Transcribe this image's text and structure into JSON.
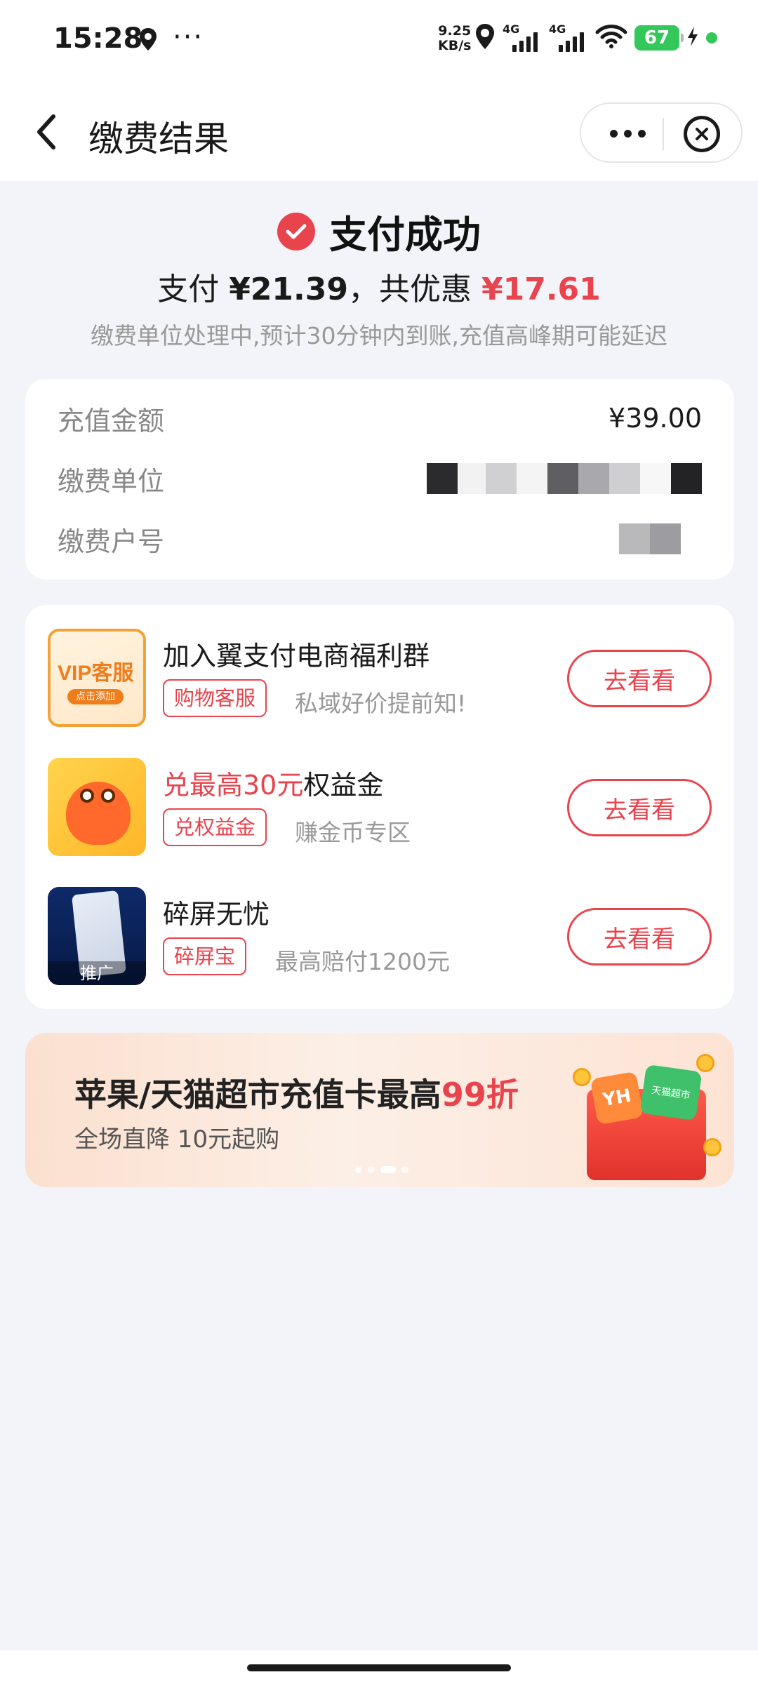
{
  "status_bar": {
    "time": "15:28",
    "more": "···",
    "net_speed_value": "9.25",
    "net_speed_unit": "KB/s",
    "signal1_label": "4G",
    "signal2_label": "4G",
    "battery_level": "67",
    "icons": [
      "location-icon",
      "signal-icon",
      "wifi-icon",
      "battery-icon",
      "charging-icon"
    ]
  },
  "nav": {
    "title": "缴费结果",
    "icons": [
      "back-icon",
      "more-icon",
      "close-icon"
    ]
  },
  "result": {
    "status": "支付成功",
    "pay_label": "支付",
    "pay_amount": "¥21.39",
    "separator": "，",
    "discount_label": "共优惠",
    "discount_amount": "¥17.61",
    "note": "缴费单位处理中,预计30分钟内到账,充值高峰期可能延迟"
  },
  "details": {
    "rows": [
      {
        "label": "充值金额",
        "value": "¥39.00"
      },
      {
        "label": "缴费单位",
        "value": ""
      },
      {
        "label": "缴费户号",
        "value": ""
      }
    ]
  },
  "promos": [
    {
      "title": "加入翼支付电商福利群",
      "title_highlight": "",
      "tag": "购物客服",
      "desc": "私域好价提前知!",
      "button": "去看看",
      "thumb_text": "VIP客服",
      "thumb_badge": "点击添加"
    },
    {
      "title": "权益金",
      "title_highlight": "兑最高30元",
      "tag": "兑权益金",
      "desc": "赚金币专区",
      "button": "去看看"
    },
    {
      "title": "碎屏无忧",
      "title_highlight": "",
      "tag": "碎屏宝",
      "desc": "最高赔付1200元",
      "button": "去看看",
      "thumb_label": "推广"
    }
  ],
  "banner": {
    "title": "苹果/天猫超市充值卡最高",
    "title_highlight": "99折",
    "subtitle": "全场直降 10元起购",
    "card1": "YH",
    "card2": "天猫超市",
    "pages": 4,
    "active_page": 3
  },
  "colors": {
    "accent": "#e9434d",
    "background": "#f3f4f9",
    "success": "#34c759"
  }
}
